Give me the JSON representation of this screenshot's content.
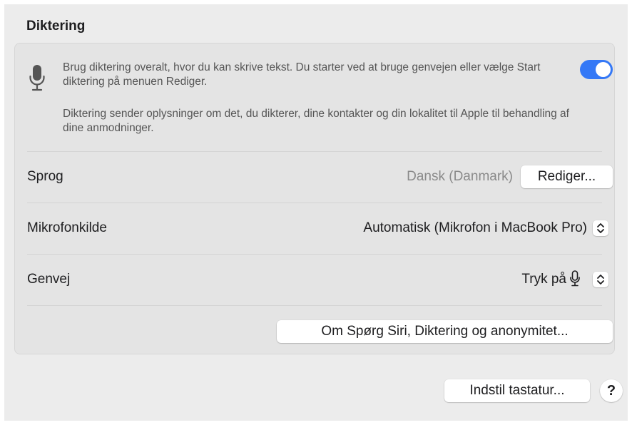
{
  "section": {
    "title": "Diktering"
  },
  "dictation": {
    "description": "Brug diktering overalt, hvor du kan skrive tekst. Du starter ved at bruge genvejen eller vælge Start diktering på menuen Rediger.",
    "privacy_note": "Diktering sender oplysninger om det, du dikterer, dine kontakter og din lokalitet til Apple til behandling af dine anmodninger.",
    "enabled": true,
    "icon": "microphone-icon"
  },
  "language": {
    "label": "Sprog",
    "value": "Dansk (Danmark)",
    "edit_button": "Rediger..."
  },
  "microphone": {
    "label": "Mikrofonkilde",
    "value": "Automatisk (Mikrofon i MacBook Pro)"
  },
  "shortcut": {
    "label": "Genvej",
    "value": "Tryk på"
  },
  "about_button": "Om Spørg Siri, Diktering og anonymitet...",
  "footer": {
    "keyboard_button": "Indstil tastatur...",
    "help_button": "?"
  },
  "colors": {
    "accent": "#3478f6",
    "pane": "#ececec",
    "group": "#e4e4e4"
  }
}
